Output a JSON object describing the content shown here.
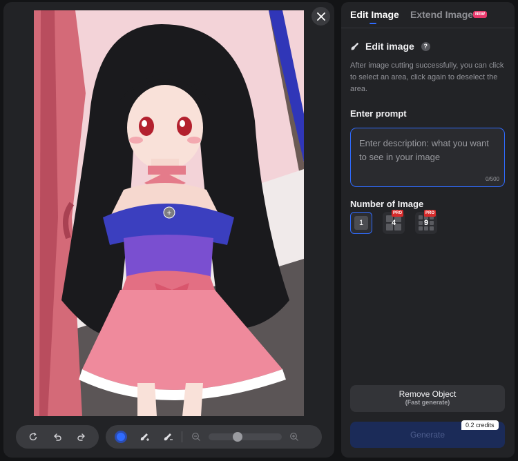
{
  "tabs": [
    {
      "label": "Edit Image",
      "active": true
    },
    {
      "label": "Extend Image",
      "active": false,
      "badge": "NEW"
    }
  ],
  "section": {
    "title": "Edit image",
    "help": "?",
    "description": "After image cutting successfully, you can click to select an area, click again to deselect the area."
  },
  "prompt": {
    "label": "Enter prompt",
    "placeholder": "Enter description: what you want to see in your image",
    "counter": "0/500"
  },
  "number_of_image": {
    "label": "Number of Image",
    "options": [
      {
        "value": "1",
        "selected": true
      },
      {
        "value": "4",
        "badge": "PRO"
      },
      {
        "value": "9",
        "badge": "PRO"
      }
    ]
  },
  "actions": {
    "remove_label": "Remove Object",
    "remove_sub": "(Fast generate)",
    "generate_label": "Generate",
    "credits": "0.2 credits"
  },
  "toolbar": {
    "brush_size": 0.38
  },
  "colors": {
    "accent": "#2f6bff",
    "panel": "#222326",
    "badge_new": "#e8386b",
    "badge_pro": "#d62b2b"
  }
}
